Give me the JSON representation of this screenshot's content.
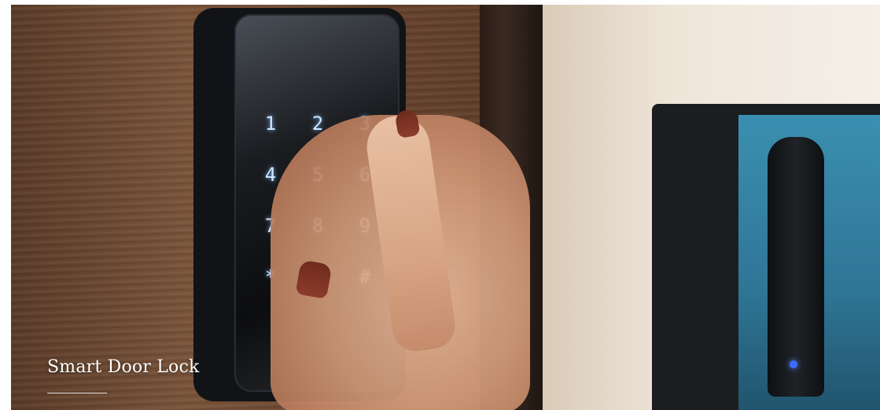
{
  "banner": {
    "caption": "Smart Door Lock"
  },
  "keypad": {
    "keys": [
      "1",
      "2",
      "3",
      "4",
      "5",
      "6",
      "7",
      "8",
      "9",
      "*",
      "",
      "#"
    ]
  },
  "colors": {
    "wood": "#6b4630",
    "wall": "#efe6da",
    "device_accent": "#3b8fb0",
    "key_glow": "#cfe6ff",
    "nail": "#7b3324"
  }
}
